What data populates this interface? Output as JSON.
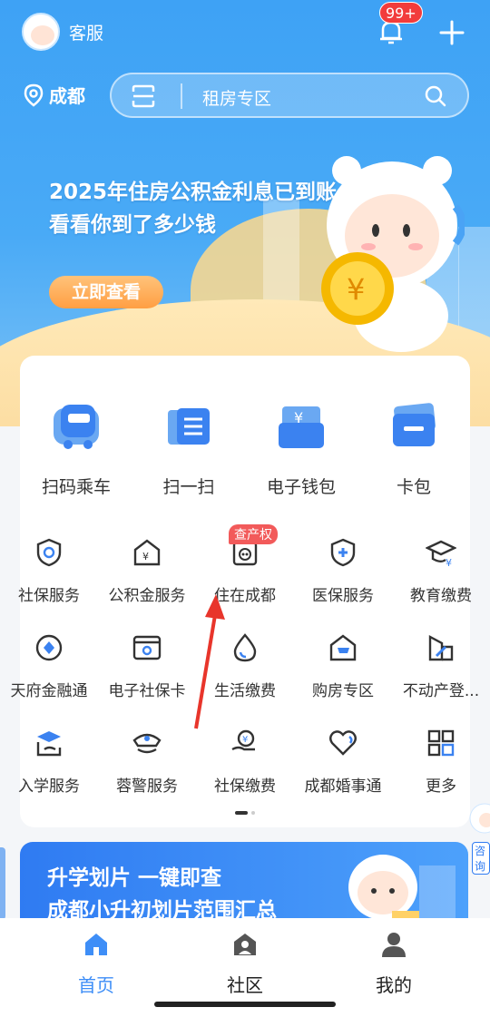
{
  "topbar": {
    "service_label": "客服",
    "notification_badge": "99+"
  },
  "location": {
    "city": "成都"
  },
  "search": {
    "placeholder": "租房专区"
  },
  "banner": {
    "line1": "2025年住房公积金利息已到账",
    "line2": "看看你到了多少钱",
    "button": "立即查看"
  },
  "main_actions": [
    {
      "label": "扫码乘车",
      "icon": "bus-scan-icon"
    },
    {
      "label": "扫一扫",
      "icon": "scan-icon"
    },
    {
      "label": "电子钱包",
      "icon": "wallet-icon"
    },
    {
      "label": "卡包",
      "icon": "card-icon"
    }
  ],
  "services": [
    {
      "label": "社保服务",
      "icon": "shield-icon"
    },
    {
      "label": "公积金服务",
      "icon": "house-yen-icon"
    },
    {
      "label": "住在成都",
      "icon": "panda-house-icon",
      "tag": "查产权"
    },
    {
      "label": "医保服务",
      "icon": "medical-shield-icon"
    },
    {
      "label": "教育缴费",
      "icon": "graduation-cap-icon"
    },
    {
      "label": "天府金融通",
      "icon": "finance-diamond-icon"
    },
    {
      "label": "电子社保卡",
      "icon": "id-card-icon"
    },
    {
      "label": "生活缴费",
      "icon": "water-drop-icon"
    },
    {
      "label": "购房专区",
      "icon": "cart-house-icon"
    },
    {
      "label": "不动产登...",
      "icon": "property-icon"
    },
    {
      "label": "入学服务",
      "icon": "school-icon"
    },
    {
      "label": "蓉警服务",
      "icon": "police-cap-icon"
    },
    {
      "label": "社保缴费",
      "icon": "hand-coin-icon"
    },
    {
      "label": "成都婚事通",
      "icon": "heart-icon"
    },
    {
      "label": "更多",
      "icon": "grid-icon"
    }
  ],
  "ad": {
    "line1": "升学划片 一键即查",
    "line2": "成都小升初划片范围汇总"
  },
  "consult_label": "咨询",
  "tabs": [
    {
      "label": "首页",
      "icon": "home-icon",
      "active": true
    },
    {
      "label": "社区",
      "icon": "community-icon",
      "active": false
    },
    {
      "label": "我的",
      "icon": "profile-icon",
      "active": false
    }
  ],
  "colors": {
    "primary": "#3e8ef7",
    "hero": "#49aaf6",
    "badge": "#f23c3c",
    "arrow": "#e8352b"
  }
}
